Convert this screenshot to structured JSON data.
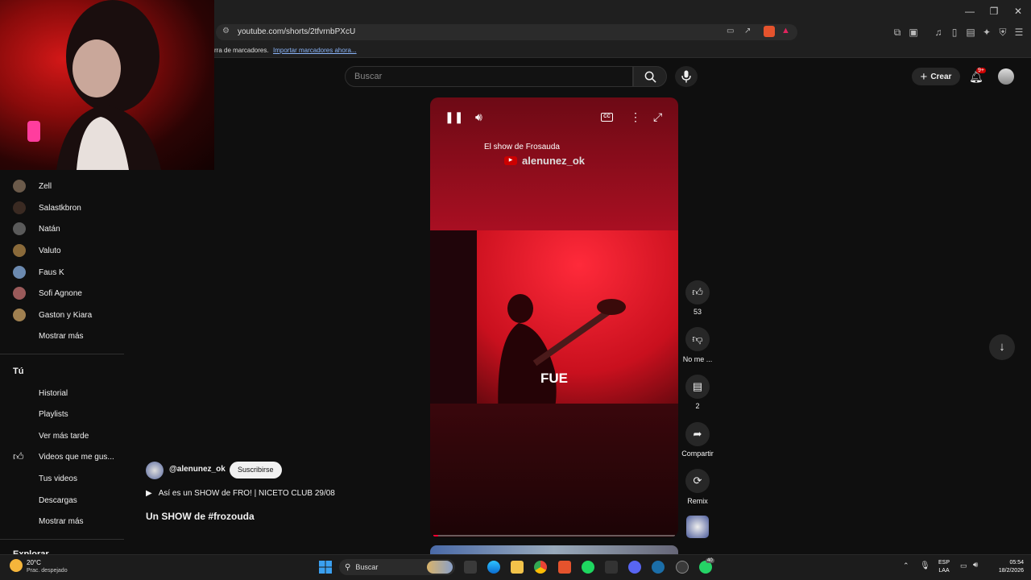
{
  "browser": {
    "url": "youtube.com/shorts/2tfvrnbPXcU",
    "bookmarks_text": "rra de marcadores.",
    "bookmarks_link": "Importar marcadores ahora..."
  },
  "header": {
    "search_placeholder": "Buscar",
    "create_label": "Crear",
    "notif_badge": "9+"
  },
  "sidebar": {
    "subscriptions": [
      {
        "label": "Zell",
        "color": "#6b5a4a"
      },
      {
        "label": "Salastkbron",
        "color": "#3a2a22"
      },
      {
        "label": "Natán",
        "color": "#5a5a5a"
      },
      {
        "label": "Valuto",
        "color": "#8a6a3a"
      },
      {
        "label": "Faus K",
        "color": "#6c8ab0"
      },
      {
        "label": "Sofi Agnone",
        "color": "#9a5a5a"
      },
      {
        "label": "Gaston y Kiara",
        "color": "#a08050"
      }
    ],
    "show_more_1": "Mostrar más",
    "you_heading": "Tú",
    "you_items": [
      "Historial",
      "Playlists",
      "Ver más tarde",
      "Videos que me gus...",
      "Tus videos",
      "Descargas"
    ],
    "show_more_2": "Mostrar más",
    "explore_partial": "Explorar"
  },
  "short": {
    "channel": "@alenunez_ok",
    "subscribe": "Suscribirse",
    "music": "Así es un SHOW de FRO! | NICETO CLUB 29/08",
    "title": "Un SHOW de #frozouda",
    "overlay_title": "El show de Frosauda",
    "overlay_watermark": "alenunez_ok",
    "caption": "FUE",
    "progress": 0.02
  },
  "actions": {
    "likes": "53",
    "dislike": "No me ...",
    "comments": "2",
    "share": "Compartir",
    "remix": "Remix"
  },
  "taskbar": {
    "weather_temp": "20°C",
    "weather_desc": "Prac. despejado",
    "search_label": "Buscar",
    "lang_1": "ESP",
    "lang_2": "LAA",
    "time": "05:54",
    "date": "18/2/2026",
    "whatsapp_badge": "40"
  }
}
